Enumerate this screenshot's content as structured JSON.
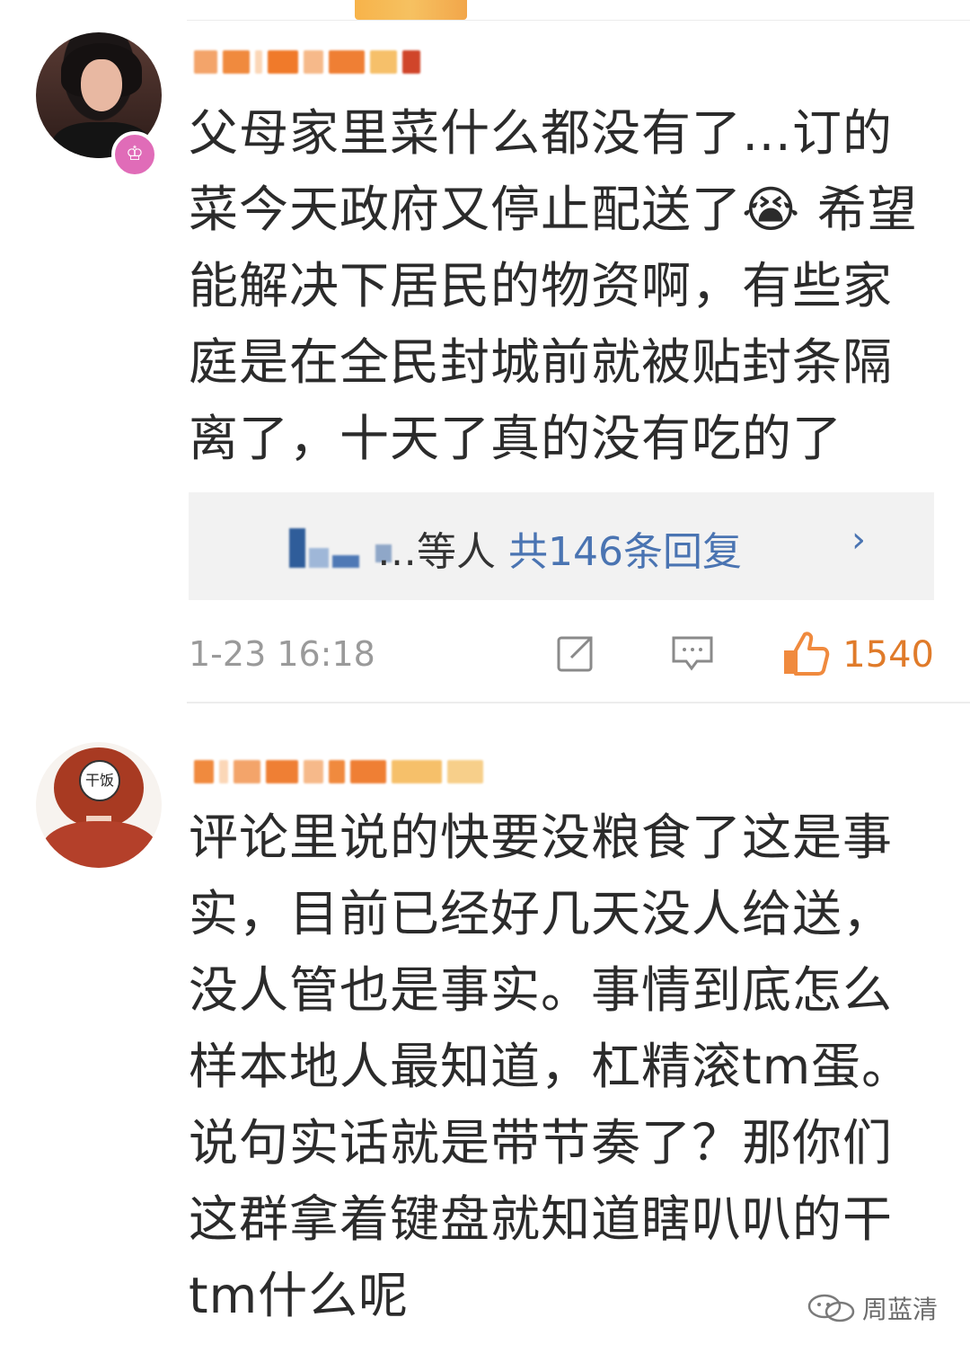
{
  "comments": [
    {
      "text": "父母家里菜什么都没有了…订的\n菜今天政府又停止配送了😭 希望\n能解决下居民的物资啊，有些家\n庭是在全民封城前就被贴封条隔\n离了，十天了真的没有吃的了",
      "replies": {
        "prefix": "…等人",
        "link": "共146条回复"
      },
      "time": "1-23 16:18",
      "likes": "1540",
      "icons": [
        "share-icon",
        "comment-icon",
        "like-icon"
      ]
    },
    {
      "text": "评论里说的快要没粮食了这是事\n实，目前已经好几天没人给送，\n没人管也是事实。事情到底怎么\n样本地人最知道，杠精滚tm蛋。\n说句实话就是带节奏了？那你们\n这群拿着键盘就知道瞎叭叭的干\ntm什么呢"
    }
  ],
  "avatar2_badge": "干饭",
  "watermark": "周蓝清",
  "colors": {
    "link": "#4a74b2",
    "likes": "#e07b2a",
    "time": "#9a9a9a"
  }
}
